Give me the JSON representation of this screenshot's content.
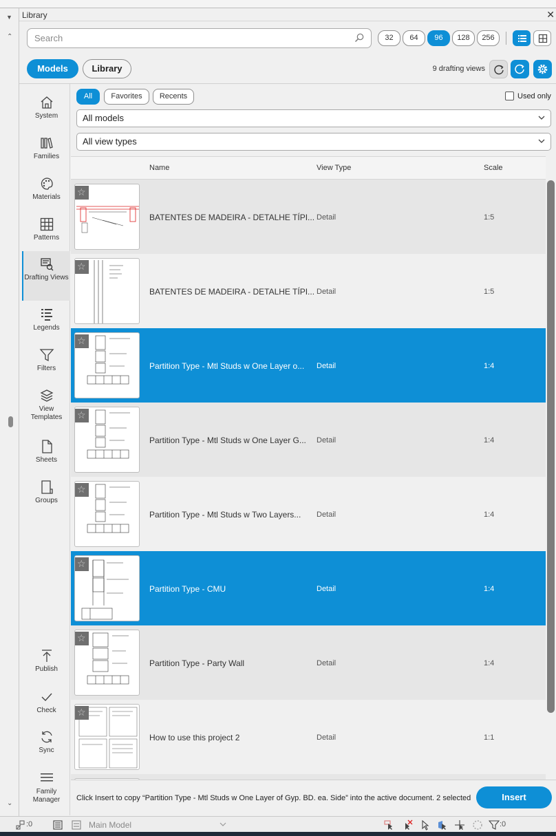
{
  "window": {
    "title": "Library",
    "close_glyph": "✕"
  },
  "search": {
    "placeholder": "Search",
    "value": ""
  },
  "thumb_sizes": [
    {
      "label": "32",
      "selected": false
    },
    {
      "label": "64",
      "selected": false
    },
    {
      "label": "96",
      "selected": true
    },
    {
      "label": "128",
      "selected": false
    },
    {
      "label": "256",
      "selected": false
    }
  ],
  "view_mode": {
    "list_selected": true,
    "list_icon": "list-icon",
    "grid_icon": "grid-icon"
  },
  "tabs": {
    "models": "Models",
    "library": "Library",
    "active": "models"
  },
  "count_text": "9 drafting views",
  "sidebar": [
    {
      "label": "System",
      "icon": "home-icon"
    },
    {
      "label": "Families",
      "icon": "books-icon"
    },
    {
      "label": "Materials",
      "icon": "palette-icon"
    },
    {
      "label": "Patterns",
      "icon": "grid-pattern-icon"
    },
    {
      "label": "Drafting Views",
      "icon": "drafting-view-icon",
      "active": true
    },
    {
      "label": "Legends",
      "icon": "legend-list-icon"
    },
    {
      "label": "Filters",
      "icon": "funnel-icon"
    },
    {
      "label": "View Templates",
      "icon": "layers-icon"
    },
    {
      "label": "Sheets",
      "icon": "sheet-icon"
    },
    {
      "label": "Groups",
      "icon": "group-icon"
    }
  ],
  "sidebar_bottom": [
    {
      "label": "Publish",
      "icon": "publish-icon"
    },
    {
      "label": "Check",
      "icon": "check-icon"
    },
    {
      "label": "Sync",
      "icon": "sync-icon"
    },
    {
      "label": "Family Manager",
      "icon": "family-manager-icon"
    }
  ],
  "filters": {
    "pills": [
      {
        "label": "All",
        "selected": true
      },
      {
        "label": "Favorites",
        "selected": false
      },
      {
        "label": "Recents",
        "selected": false
      }
    ],
    "used_only_label": "Used only",
    "used_only_checked": false,
    "models_dropdown": "All models",
    "view_types_dropdown": "All view types"
  },
  "table": {
    "columns": {
      "name": "Name",
      "view_type": "View Type",
      "scale": "Scale"
    },
    "rows": [
      {
        "name": "BATENTES DE MADEIRA - DETALHE TÍPI...",
        "view_type": "Detail",
        "scale": "1:5",
        "selected": false
      },
      {
        "name": "BATENTES DE MADEIRA - DETALHE TÍPI...",
        "view_type": "Detail",
        "scale": "1:5",
        "selected": false
      },
      {
        "name": "Partition Type - Mtl Studs w One Layer o...",
        "view_type": "Detail",
        "scale": "1:4",
        "selected": true
      },
      {
        "name": "Partition Type - Mtl Studs w One Layer G...",
        "view_type": "Detail",
        "scale": "1:4",
        "selected": false
      },
      {
        "name": "Partition Type - Mtl Studs w Two Layers...",
        "view_type": "Detail",
        "scale": "1:4",
        "selected": false
      },
      {
        "name": "Partition Type - CMU",
        "view_type": "Detail",
        "scale": "1:4",
        "selected": true
      },
      {
        "name": "Partition Type - Party Wall",
        "view_type": "Detail",
        "scale": "1:4",
        "selected": false
      },
      {
        "name": "How to use this project 2",
        "view_type": "Detail",
        "scale": "1:1",
        "selected": false
      }
    ]
  },
  "footer": {
    "message": "Click Insert to copy “Partition Type - Mtl Studs w One Layer of Gyp. BD. ea. Side” into the active document. 2 selected",
    "insert_label": "Insert"
  },
  "status_bar": {
    "left_count": ":0",
    "model_name": "Main Model",
    "filter_count": ":0"
  },
  "colors": {
    "accent": "#0e8fd6",
    "row_bg": "#e6e6e6",
    "row_alt_bg": "#f0f0f0"
  }
}
